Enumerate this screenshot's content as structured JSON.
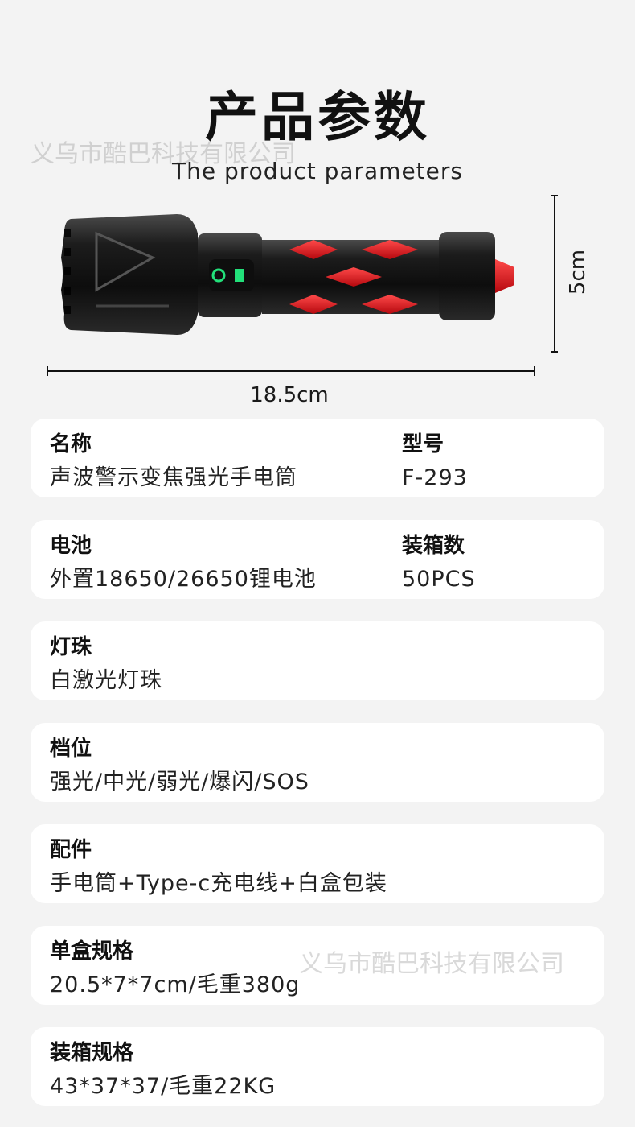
{
  "header": {
    "title": "产品参数",
    "subtitle": "The  product parameters",
    "watermark": "义乌市酷巴科技有限公司"
  },
  "product": {
    "image": "flashlight-image",
    "height_label": "5cm",
    "length_label": "18.5cm",
    "colors": {
      "body": "#1b1b1b",
      "accent": "#e8222a",
      "button_glow": "#22e07a"
    }
  },
  "specs": [
    {
      "left": {
        "label": "名称",
        "value": "声波警示变焦强光手电筒"
      },
      "right": {
        "label": "型号",
        "value": "F-293"
      }
    },
    {
      "left": {
        "label": "电池",
        "value": "外置18650/26650锂电池"
      },
      "right": {
        "label": "装箱数",
        "value": "50PCS"
      }
    },
    {
      "left": {
        "label": "灯珠",
        "value": "白激光灯珠"
      }
    },
    {
      "left": {
        "label": "档位",
        "value": "强光/中光/弱光/爆闪/SOS"
      }
    },
    {
      "left": {
        "label": "配件",
        "value": "手电筒+Type-c充电线+白盒包装"
      }
    },
    {
      "left": {
        "label": "单盒规格",
        "value": "20.5*7*7cm/毛重380g"
      }
    },
    {
      "left": {
        "label": "装箱规格",
        "value": "43*37*37/毛重22KG"
      }
    }
  ]
}
